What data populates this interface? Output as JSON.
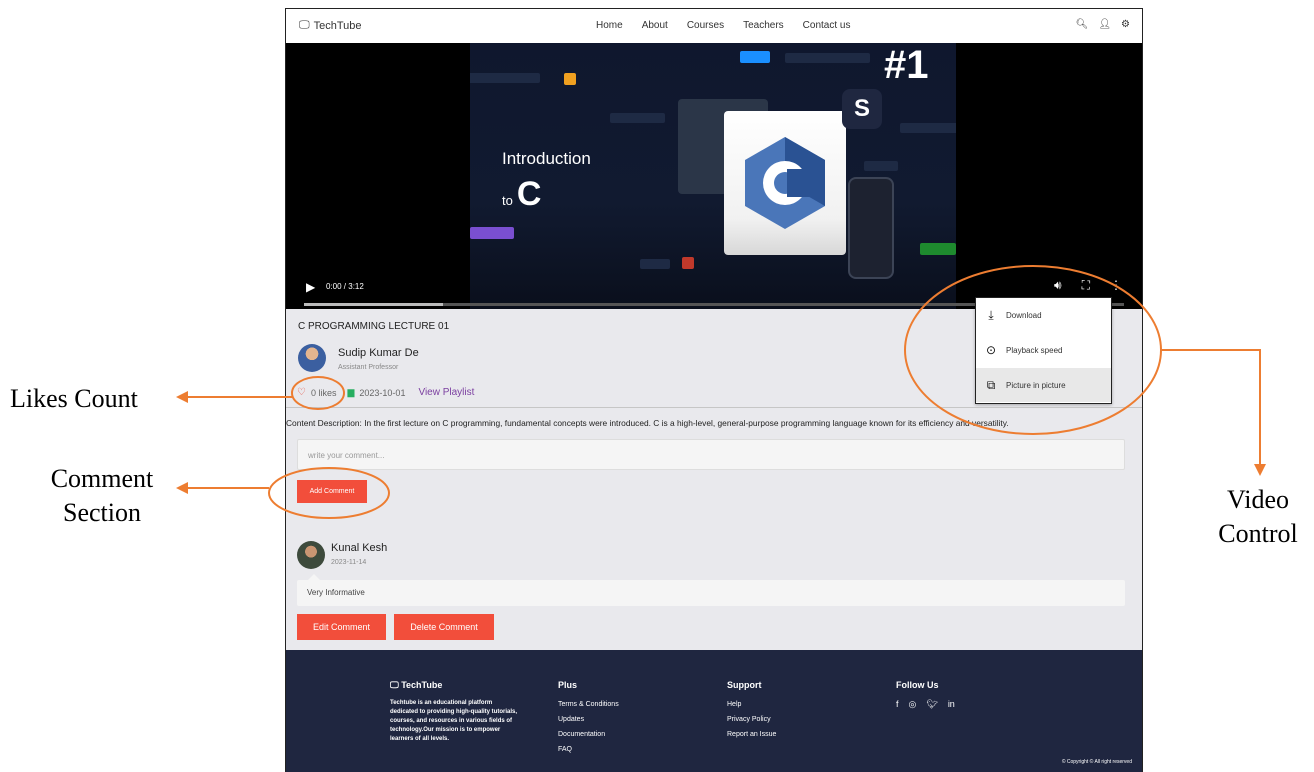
{
  "annotations": {
    "likes_count": "Likes Count",
    "comment_section_line1": "Comment",
    "comment_section_line2": "Section",
    "video_control_line1": "Video",
    "video_control_line2": "Control"
  },
  "nav": {
    "brand": "TechTube",
    "links": [
      "Home",
      "About",
      "Courses",
      "Teachers",
      "Contact us"
    ]
  },
  "video": {
    "thumbnail_title": "Introduction",
    "thumbnail_to": "to",
    "thumbnail_letter": "C",
    "thumbnail_number": "#1",
    "time": "0:00 / 3:12",
    "progress": 0.17,
    "menu": [
      "Download",
      "Playback speed",
      "Picture in picture"
    ]
  },
  "lecture": {
    "title": "C PROGRAMMING LECTURE 01",
    "author": "Sudip Kumar De",
    "role": "Assistant Professor",
    "likes": "0 likes",
    "date": "2023-10-01",
    "playlist": "View Playlist",
    "description": "Content Description: In the first lecture on C programming, fundamental concepts were introduced. C is a high-level, general-purpose programming language known for its efficiency and versatility."
  },
  "comment_form": {
    "placeholder": "write your comment...",
    "add_label": "Add Comment"
  },
  "comments": [
    {
      "name": "Kunal Kesh",
      "date": "2023-11-14",
      "text": "Very Informative",
      "edit_label": "Edit Comment",
      "delete_label": "Delete Comment"
    }
  ],
  "footer": {
    "brand": "TechTube",
    "about": "Techtube is an educational platform dedicated to providing high-quality tutorials, courses, and resources in various fields of technology.Our mission is to empower learners of all levels.",
    "plus_title": "Plus",
    "plus_links": [
      "Terms & Conditions",
      "Updates",
      "Documentation",
      "FAQ"
    ],
    "support_title": "Support",
    "support_links": [
      "Help",
      "Privacy Policy",
      "Report an Issue"
    ],
    "follow_title": "Follow Us",
    "copyright": "© Copyright © All right reserved"
  },
  "colors": {
    "accent": "#f24e3b",
    "annotation": "#ed7d31",
    "footer_bg": "#1f2640",
    "playlist": "#7b3fa0"
  }
}
